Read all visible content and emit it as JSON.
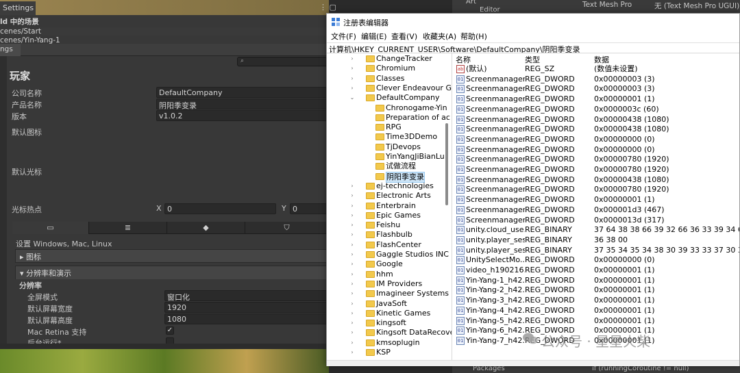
{
  "unity": {
    "settings_tab": "Settings",
    "build_scenes_title": "ld 中的场景",
    "scene1": "cenes/Start",
    "scene2": "cenes/Yin-Yang-1",
    "ps_tab": "ngs",
    "player_title": "玩家",
    "company_label": "公司名称",
    "company_value": "DefaultCompany",
    "product_label": "产品名称",
    "product_value": "阴阳季变录",
    "version_label": "版本",
    "version_value": "v1.0.2",
    "default_icon_label": "默认图标",
    "default_cursor_label": "默认光标",
    "hotspot_label": "光标热点",
    "hotspot_x_label": "X",
    "hotspot_x": "0",
    "hotspot_y_label": "Y",
    "hotspot_y": "0",
    "platform_caption": "设置 Windows, Mac, Linux",
    "icon_section": "图标",
    "resolution_section": "分辨率和演示",
    "resolution_sub": "分辨率",
    "fullscreen_label": "全屏模式",
    "fullscreen_value": "窗口化",
    "width_label": "默认屏幕宽度",
    "width_value": "1920",
    "height_label": "默认屏幕高度",
    "height_value": "1080",
    "retina_label": "Mac Retina 支持",
    "retina_checked": "✓",
    "bg_run_label": "后台运行*",
    "right_top_art": "Art",
    "right_top_editor": "Editor",
    "right_top_tmp": "Text Mesh Pro",
    "right_top_tmp_value": "无 (Text Mesh Pro UGUI)",
    "right_bottom_packages": "Packages",
    "right_bottom_code": "if (runningCoroutine != null)"
  },
  "regedit": {
    "title": "注册表编辑器",
    "menu": [
      "文件(F)",
      "编辑(E)",
      "查看(V)",
      "收藏夹(A)",
      "帮助(H)"
    ],
    "path": "计算机\\HKEY_CURRENT_USER\\Software\\DefaultCompany\\阴阳季变录",
    "tree": [
      {
        "label": "ChangeTracker",
        "level": 0,
        "chevron": "›"
      },
      {
        "label": "Chromium",
        "level": 0,
        "chevron": "›"
      },
      {
        "label": "Classes",
        "level": 0,
        "chevron": "›"
      },
      {
        "label": "Clever Endeavour G",
        "level": 0,
        "chevron": "›"
      },
      {
        "label": "DefaultCompany",
        "level": 0,
        "chevron": "⌄"
      },
      {
        "label": "Chronogame-Yin",
        "level": 1,
        "chevron": ""
      },
      {
        "label": "Preparation of ac",
        "level": 1,
        "chevron": ""
      },
      {
        "label": "RPG",
        "level": 1,
        "chevron": ""
      },
      {
        "label": "Time3DDemo",
        "level": 1,
        "chevron": ""
      },
      {
        "label": "TjDevops",
        "level": 1,
        "chevron": ""
      },
      {
        "label": "YinYangJiBianLu",
        "level": 1,
        "chevron": ""
      },
      {
        "label": "试做流程",
        "level": 1,
        "chevron": ""
      },
      {
        "label": "阴阳季变录",
        "level": 1,
        "chevron": "",
        "selected": true
      },
      {
        "label": "ej-technologies",
        "level": 0,
        "chevron": "›"
      },
      {
        "label": "Electronic Arts",
        "level": 0,
        "chevron": "›"
      },
      {
        "label": "Enterbrain",
        "level": 0,
        "chevron": "›"
      },
      {
        "label": "Epic Games",
        "level": 0,
        "chevron": "›"
      },
      {
        "label": "Feishu",
        "level": 0,
        "chevron": "›"
      },
      {
        "label": "Flashbulb",
        "level": 0,
        "chevron": "›"
      },
      {
        "label": "FlashCenter",
        "level": 0,
        "chevron": "›"
      },
      {
        "label": "Gaggle Studios INC",
        "level": 0,
        "chevron": "›"
      },
      {
        "label": "Google",
        "level": 0,
        "chevron": "›"
      },
      {
        "label": "hhm",
        "level": 0,
        "chevron": "›"
      },
      {
        "label": "IM Providers",
        "level": 0,
        "chevron": "›"
      },
      {
        "label": "Imagineer Systems I",
        "level": 0,
        "chevron": "›"
      },
      {
        "label": "JavaSoft",
        "level": 0,
        "chevron": "›"
      },
      {
        "label": "Kinetic Games",
        "level": 0,
        "chevron": "›"
      },
      {
        "label": "kingsoft",
        "level": 0,
        "chevron": "›"
      },
      {
        "label": "Kingsoft DataRecove",
        "level": 0,
        "chevron": "›"
      },
      {
        "label": "kmsoplugin",
        "level": 0,
        "chevron": "›"
      },
      {
        "label": "KSP",
        "level": 0,
        "chevron": "›"
      }
    ],
    "columns": {
      "name": "名称",
      "type": "类型",
      "data": "数据"
    },
    "values": [
      {
        "icon": "ab",
        "name": "(默认)",
        "type": "REG_SZ",
        "data": "(数值未设置)"
      },
      {
        "icon": "01",
        "name": "Screenmanager...",
        "type": "REG_DWORD",
        "data": "0x00000003 (3)"
      },
      {
        "icon": "01",
        "name": "Screenmanager...",
        "type": "REG_DWORD",
        "data": "0x00000003 (3)"
      },
      {
        "icon": "01",
        "name": "Screenmanager...",
        "type": "REG_DWORD",
        "data": "0x00000001 (1)"
      },
      {
        "icon": "01",
        "name": "Screenmanager...",
        "type": "REG_DWORD",
        "data": "0x0000003c (60)"
      },
      {
        "icon": "01",
        "name": "Screenmanager...",
        "type": "REG_DWORD",
        "data": "0x00000438 (1080)"
      },
      {
        "icon": "01",
        "name": "Screenmanager...",
        "type": "REG_DWORD",
        "data": "0x00000438 (1080)"
      },
      {
        "icon": "01",
        "name": "Screenmanager...",
        "type": "REG_DWORD",
        "data": "0x00000000 (0)"
      },
      {
        "icon": "01",
        "name": "Screenmanager...",
        "type": "REG_DWORD",
        "data": "0x00000000 (0)"
      },
      {
        "icon": "01",
        "name": "Screenmanager...",
        "type": "REG_DWORD",
        "data": "0x00000780 (1920)"
      },
      {
        "icon": "01",
        "name": "Screenmanager...",
        "type": "REG_DWORD",
        "data": "0x00000780 (1920)"
      },
      {
        "icon": "01",
        "name": "Screenmanager...",
        "type": "REG_DWORD",
        "data": "0x00000438 (1080)"
      },
      {
        "icon": "01",
        "name": "Screenmanager...",
        "type": "REG_DWORD",
        "data": "0x00000780 (1920)"
      },
      {
        "icon": "01",
        "name": "Screenmanager...",
        "type": "REG_DWORD",
        "data": "0x00000001 (1)"
      },
      {
        "icon": "01",
        "name": "Screenmanager...",
        "type": "REG_DWORD",
        "data": "0x000001d3 (467)"
      },
      {
        "icon": "01",
        "name": "Screenmanager...",
        "type": "REG_DWORD",
        "data": "0x0000013d (317)"
      },
      {
        "icon": "01",
        "name": "unity.cloud_use...",
        "type": "REG_BINARY",
        "data": "37 64 38 38 66 39 32 66 36 33 39 34 62 62 62"
      },
      {
        "icon": "01",
        "name": "unity.player_ses...",
        "type": "REG_BINARY",
        "data": "36 38 00"
      },
      {
        "icon": "01",
        "name": "unity.player_ses...",
        "type": "REG_BINARY",
        "data": "37 35 34 35 34 38 30 39 33 33 37 30 33 39 30"
      },
      {
        "icon": "01",
        "name": "UnitySelectMo...",
        "type": "REG_DWORD",
        "data": "0x00000000 (0)"
      },
      {
        "icon": "01",
        "name": "video_h190216...",
        "type": "REG_DWORD",
        "data": "0x00000001 (1)"
      },
      {
        "icon": "01",
        "name": "Yin-Yang-1_h42...",
        "type": "REG_DWORD",
        "data": "0x00000001 (1)"
      },
      {
        "icon": "01",
        "name": "Yin-Yang-2_h42...",
        "type": "REG_DWORD",
        "data": "0x00000001 (1)"
      },
      {
        "icon": "01",
        "name": "Yin-Yang-3_h42...",
        "type": "REG_DWORD",
        "data": "0x00000001 (1)"
      },
      {
        "icon": "01",
        "name": "Yin-Yang-4_h42...",
        "type": "REG_DWORD",
        "data": "0x00000001 (1)"
      },
      {
        "icon": "01",
        "name": "Yin-Yang-5_h42...",
        "type": "REG_DWORD",
        "data": "0x00000001 (1)"
      },
      {
        "icon": "01",
        "name": "Yin-Yang-6_h42...",
        "type": "REG_DWORD",
        "data": "0x00000001 (1)"
      },
      {
        "icon": "01",
        "name": "Yin-Yang-7_h42...",
        "type": "REG_DWORD",
        "data": "0x00000001 (1)"
      }
    ]
  },
  "watermark": "公众号 · 星星火柴"
}
